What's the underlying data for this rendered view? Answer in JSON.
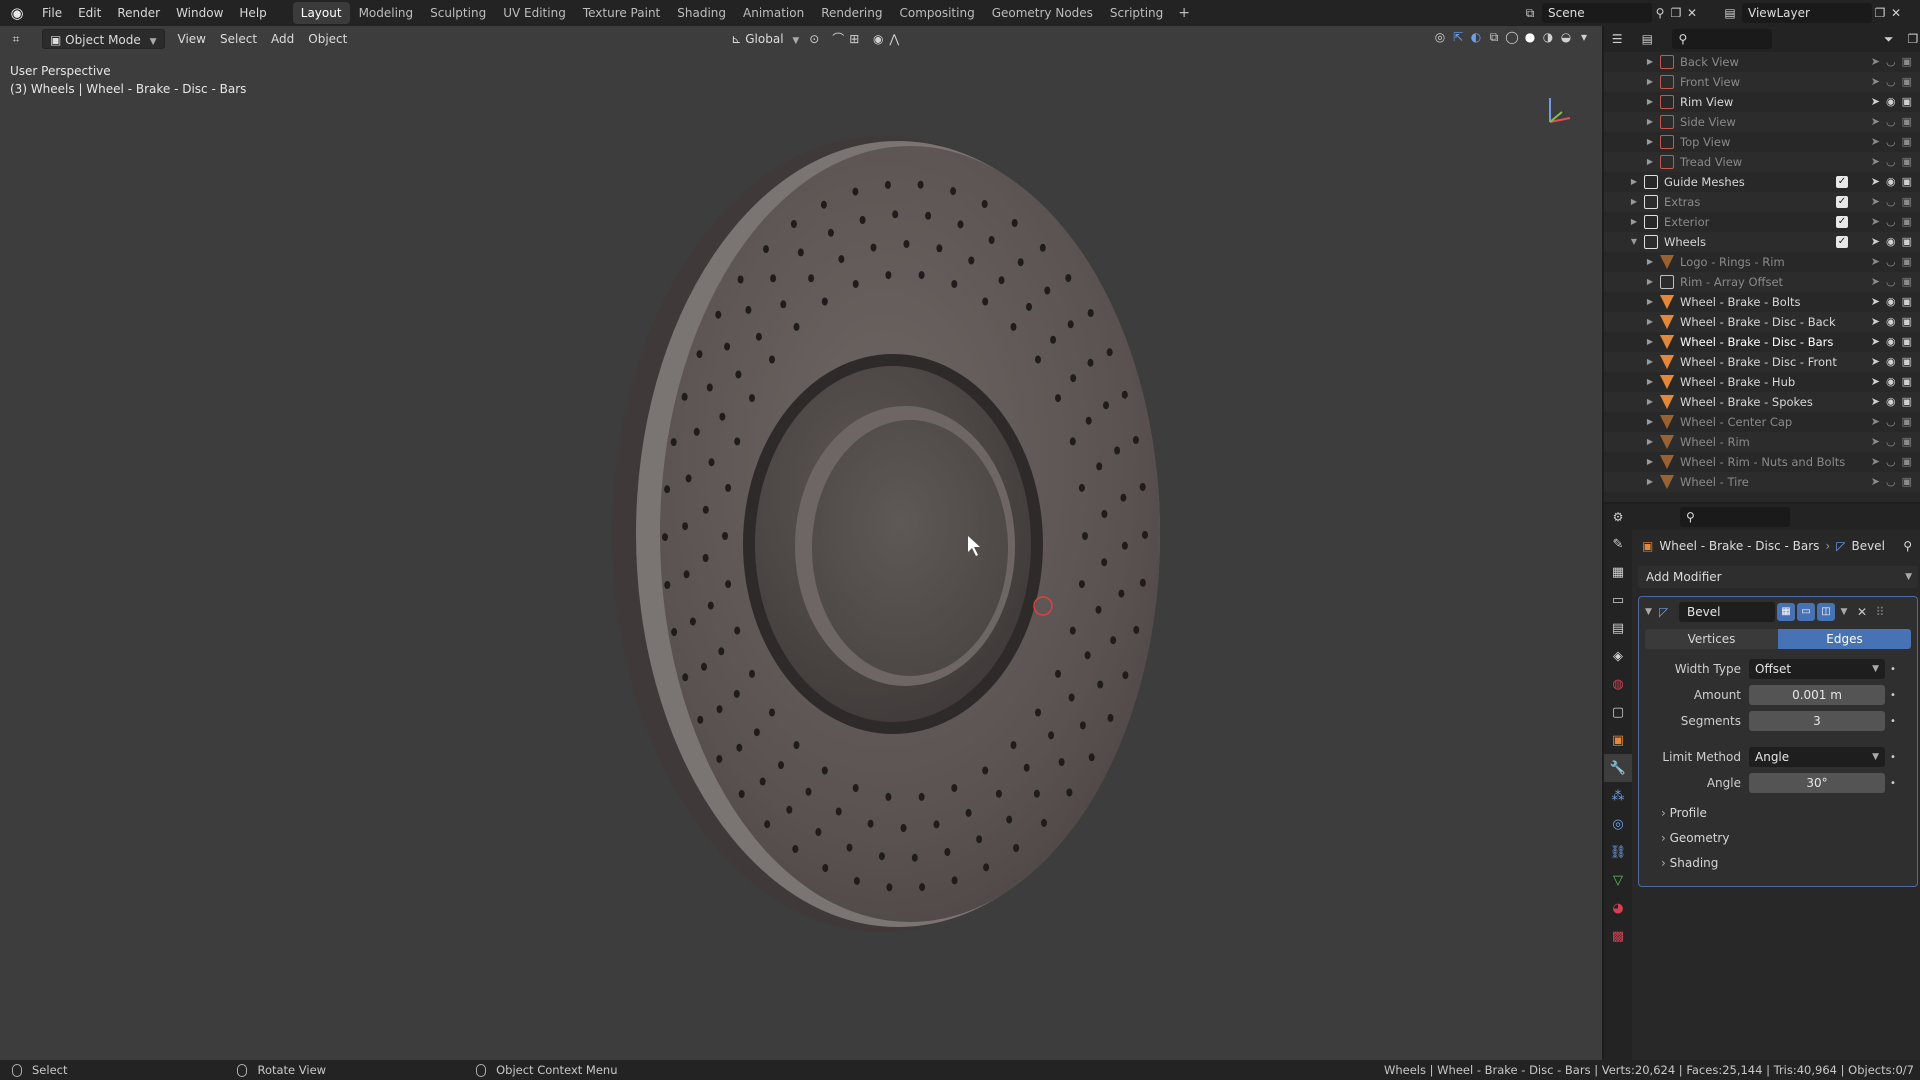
{
  "topbar": {
    "menus": [
      "File",
      "Edit",
      "Render",
      "Window",
      "Help"
    ],
    "workspaces": [
      "Layout",
      "Modeling",
      "Sculpting",
      "UV Editing",
      "Texture Paint",
      "Shading",
      "Animation",
      "Rendering",
      "Compositing",
      "Geometry Nodes",
      "Scripting"
    ],
    "active_workspace": "Layout",
    "scene": "Scene",
    "view_layer": "ViewLayer"
  },
  "viewport": {
    "mode": "Object Mode",
    "menus": [
      "View",
      "Select",
      "Add",
      "Object"
    ],
    "transform_orientation": "Global",
    "view_name": "User Perspective",
    "object_info": "(3) Wheels | Wheel - Brake - Disc - Bars"
  },
  "outliner": {
    "rows": [
      {
        "label": "Back View",
        "indent": 2,
        "icon": "image-icon",
        "dim": true
      },
      {
        "label": "Front View",
        "indent": 2,
        "icon": "image-icon",
        "dim": true
      },
      {
        "label": "Rim View",
        "indent": 2,
        "icon": "image-icon",
        "dim": false
      },
      {
        "label": "Side View",
        "indent": 2,
        "icon": "image-icon",
        "dim": true
      },
      {
        "label": "Top View",
        "indent": 2,
        "icon": "image-icon",
        "dim": true
      },
      {
        "label": "Tread View",
        "indent": 2,
        "icon": "image-icon",
        "dim": true
      },
      {
        "label": "Guide Meshes",
        "indent": 1,
        "icon": "collection-icon",
        "dim": false,
        "checkbox": true
      },
      {
        "label": "Extras",
        "indent": 1,
        "icon": "collection-icon",
        "dim": true,
        "checkbox": true
      },
      {
        "label": "Exterior",
        "indent": 1,
        "icon": "collection-icon",
        "dim": true,
        "checkbox": true
      },
      {
        "label": "Wheels",
        "indent": 1,
        "icon": "collection-icon",
        "dim": false,
        "checkbox": true,
        "expanded": true
      },
      {
        "label": "Logo - Rings - Rim",
        "indent": 2,
        "icon": "mesh-icon",
        "dim": true
      },
      {
        "label": "Rim - Array Offset",
        "indent": 2,
        "icon": "empty-icon",
        "dim": true
      },
      {
        "label": "Wheel - Brake - Bolts",
        "indent": 2,
        "icon": "mesh-icon",
        "dim": false
      },
      {
        "label": "Wheel - Brake - Disc - Back",
        "indent": 2,
        "icon": "mesh-icon",
        "dim": false
      },
      {
        "label": "Wheel - Brake - Disc - Bars",
        "indent": 2,
        "icon": "mesh-icon",
        "dim": false,
        "selected": true
      },
      {
        "label": "Wheel - Brake - Disc - Front",
        "indent": 2,
        "icon": "mesh-icon",
        "dim": false
      },
      {
        "label": "Wheel - Brake - Hub",
        "indent": 2,
        "icon": "mesh-icon",
        "dim": false
      },
      {
        "label": "Wheel - Brake - Spokes",
        "indent": 2,
        "icon": "mesh-icon",
        "dim": false
      },
      {
        "label": "Wheel - Center Cap",
        "indent": 2,
        "icon": "mesh-icon",
        "dim": true
      },
      {
        "label": "Wheel - Rim",
        "indent": 2,
        "icon": "mesh-icon",
        "dim": true
      },
      {
        "label": "Wheel - Rim - Nuts and Bolts",
        "indent": 2,
        "icon": "mesh-icon",
        "dim": true
      },
      {
        "label": "Wheel - Tire",
        "indent": 2,
        "icon": "mesh-icon",
        "dim": true
      }
    ]
  },
  "properties": {
    "object_name": "Wheel - Brake - Disc - Bars",
    "modifier_crumb": "Bevel",
    "add_modifier": "Add Modifier",
    "modifier": {
      "name": "Bevel",
      "affect_options": [
        "Vertices",
        "Edges"
      ],
      "affect_active": "Edges",
      "width_type_label": "Width Type",
      "width_type": "Offset",
      "amount_label": "Amount",
      "amount": "0.001 m",
      "segments_label": "Segments",
      "segments": "3",
      "limit_method_label": "Limit Method",
      "limit_method": "Angle",
      "angle_label": "Angle",
      "angle": "30°",
      "subpanels": [
        "Profile",
        "Geometry",
        "Shading"
      ]
    }
  },
  "statusbar": {
    "hints": [
      "Select",
      "Rotate View",
      "Object Context Menu"
    ],
    "stats": "Wheels | Wheel - Brake - Disc - Bars | Verts:20,624 | Faces:25,144 | Tris:40,964 | Objects:0/7"
  },
  "colors": {
    "accent": "#4772b3",
    "mesh_icon": "#e3883a",
    "selection_outline": "#4c6aa8"
  }
}
